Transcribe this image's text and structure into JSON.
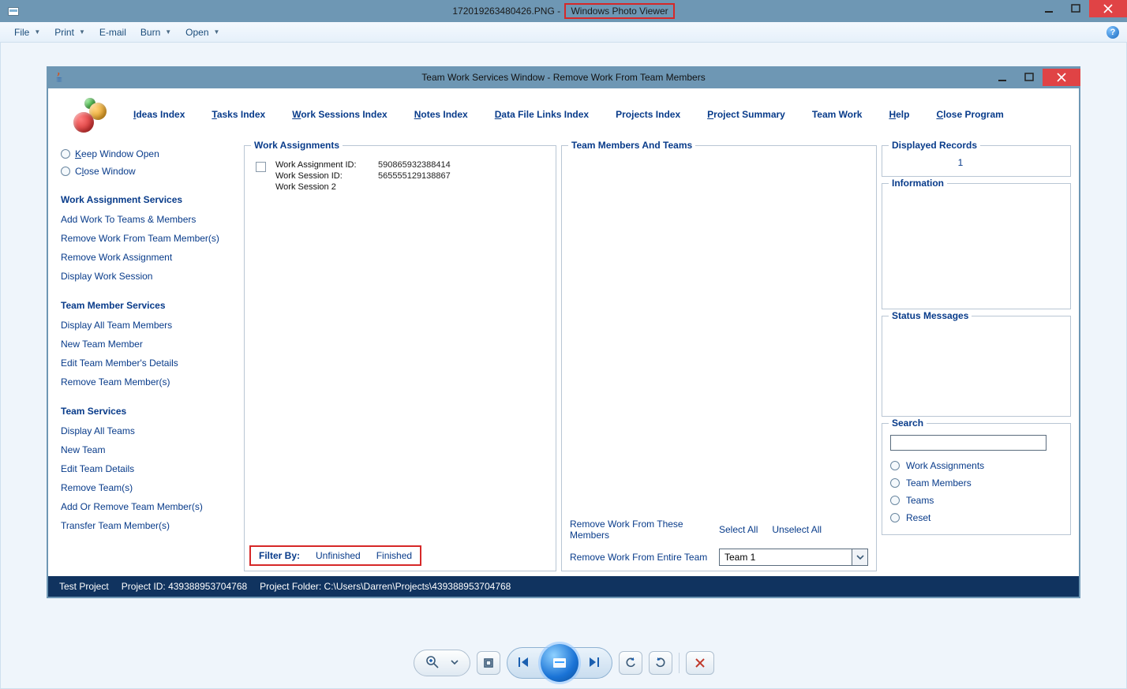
{
  "outer": {
    "title_file": "172019263480426.PNG",
    "title_sep": " - ",
    "title_app": "Windows Photo Viewer",
    "menu": {
      "file": "File",
      "print": "Print",
      "email": "E-mail",
      "burn": "Burn",
      "open": "Open"
    }
  },
  "inner": {
    "title": "Team Work Services Window - Remove Work From Team Members",
    "nav": {
      "ideas": "Ideas Index",
      "tasks": "Tasks Index",
      "work_sessions": "Work Sessions Index",
      "notes": "Notes Index",
      "datafile": "Data File Links Index",
      "projects": "Projects Index",
      "summary": "Project Summary",
      "teamwork": "Team Work",
      "help": "Help",
      "close": "Close Program"
    },
    "sidebar": {
      "keep_open": "Keep Window Open",
      "close_window": "Close Window",
      "sec1": "Work Assignment Services",
      "sec1_items": {
        "add": "Add Work To Teams & Members",
        "remove_members": "Remove Work From Team Member(s)",
        "remove_assign": "Remove Work Assignment",
        "display_ws": "Display Work Session"
      },
      "sec2": "Team Member Services",
      "sec2_items": {
        "display_all": "Display All Team Members",
        "new_member": "New Team Member",
        "edit_member": "Edit Team Member's Details",
        "remove_member": "Remove Team Member(s)"
      },
      "sec3": "Team Services",
      "sec3_items": {
        "display_teams": "Display All Teams",
        "new_team": "New Team",
        "edit_team": "Edit Team Details",
        "remove_team": "Remove Team(s)",
        "addrem_members": "Add Or Remove Team Member(s)",
        "transfer": "Transfer Team Member(s)"
      }
    },
    "work_assignments": {
      "title": "Work Assignments",
      "item": {
        "wa_label": "Work Assignment ID:",
        "wa_val": "590865932388414",
        "ws_label": "Work Session ID:",
        "ws_val": "565555129138867",
        "ws_name": "Work Session 2"
      },
      "filter_label": "Filter By:",
      "filter_unfinished": "Unfinished",
      "filter_finished": "Finished"
    },
    "team_panel": {
      "title": "Team Members And Teams",
      "remove_members_label": "Remove Work From These Members",
      "select_all": "Select All",
      "unselect_all": "Unselect All",
      "remove_team_label": "Remove Work From Entire Team",
      "team_selected": "Team 1"
    },
    "right": {
      "displayed_title": "Displayed Records",
      "displayed_value": "1",
      "information_title": "Information",
      "status_title": "Status Messages",
      "search_title": "Search",
      "search_opts": {
        "work": "Work Assignments",
        "members": "Team Members",
        "teams": "Teams",
        "reset": "Reset"
      }
    },
    "status": {
      "project": "Test Project",
      "project_id_label": "Project ID:",
      "project_id": "439388953704768",
      "folder_label": "Project Folder:",
      "folder": "C:\\Users\\Darren\\Projects\\439388953704768"
    }
  }
}
